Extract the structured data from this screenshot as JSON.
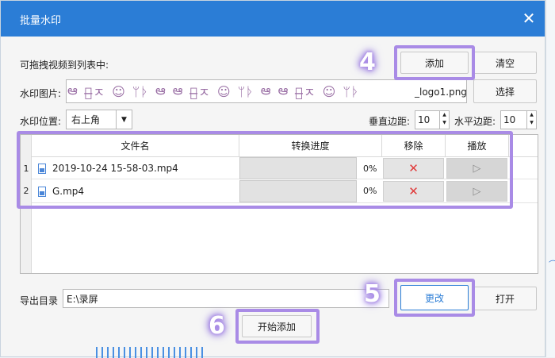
{
  "dialog": {
    "title": "批量水印",
    "close_glyph": "✕"
  },
  "drag_hint": "可拖拽视频到列表中:",
  "buttons": {
    "add": "添加",
    "clear": "清空",
    "choose": "选择",
    "change": "更改",
    "open": "打开",
    "start": "开始添加"
  },
  "watermark": {
    "label": "水印图片:",
    "file_suffix": "_logo1.png",
    "glyphs": [
      "ఆ",
      "ㄷ̶ㅈ",
      "☺",
      "ᛘᚦ",
      "ఆ",
      "ఆ",
      "ㄷ̶ㅈ",
      "☺",
      "ᛘᚦ",
      "ఆ",
      "ఆ",
      "ㄷ̶ㅈ",
      "☺",
      "ᛘᚦ"
    ]
  },
  "position": {
    "label": "水印位置:",
    "value": "右上角"
  },
  "margins": {
    "vertical_label": "垂直边距:",
    "vertical_value": "10",
    "horizontal_label": "水平边距:",
    "horizontal_value": "10"
  },
  "table": {
    "columns": [
      "文件名",
      "转换进度",
      "移除",
      "播放"
    ],
    "rows": [
      {
        "index": "1",
        "filename": "2019-10-24 15-58-03.mp4",
        "progress": 0,
        "progress_text": "0%"
      },
      {
        "index": "2",
        "filename": "G.mp4",
        "progress": 0,
        "progress_text": "0%"
      }
    ]
  },
  "output": {
    "label": "导出目录",
    "path": "E:\\录屏"
  },
  "step_markers": [
    "4",
    "5",
    "6"
  ],
  "colors": {
    "titlebar": "#2b7dd6",
    "highlight": "#a98be6",
    "remove_icon": "#e03a3a"
  }
}
